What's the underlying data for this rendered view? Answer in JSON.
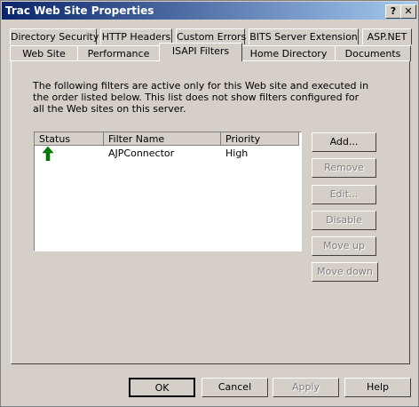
{
  "window": {
    "title": "Trac Web Site Properties",
    "help_label": "?",
    "close_label": "✕"
  },
  "tabs_row1": [
    "Directory Security",
    "HTTP Headers",
    "Custom Errors",
    "BITS Server Extension",
    "ASP.NET"
  ],
  "tabs_row2": [
    "Web Site",
    "Performance",
    "ISAPI Filters",
    "Home Directory",
    "Documents"
  ],
  "active_tab": "ISAPI Filters",
  "description": "The following filters are active only for this Web site and executed in the order listed below. This list does not show filters configured for all the Web sites on this server.",
  "filters": {
    "columns": [
      "Status",
      "Filter Name",
      "Priority"
    ],
    "rows": [
      {
        "status_icon": "green-up-arrow-icon",
        "name": "AJPConnector",
        "priority": "High"
      }
    ]
  },
  "side_buttons": {
    "add": "Add...",
    "remove": "Remove",
    "edit": "Edit...",
    "disable": "Disable",
    "move_up": "Move up",
    "move_down": "Move down"
  },
  "bottom_buttons": {
    "ok": "OK",
    "cancel": "Cancel",
    "apply": "Apply",
    "help": "Help"
  },
  "colors": {
    "title_start": "#0a246a",
    "title_end": "#a6caf0",
    "status_green": "#008000"
  }
}
